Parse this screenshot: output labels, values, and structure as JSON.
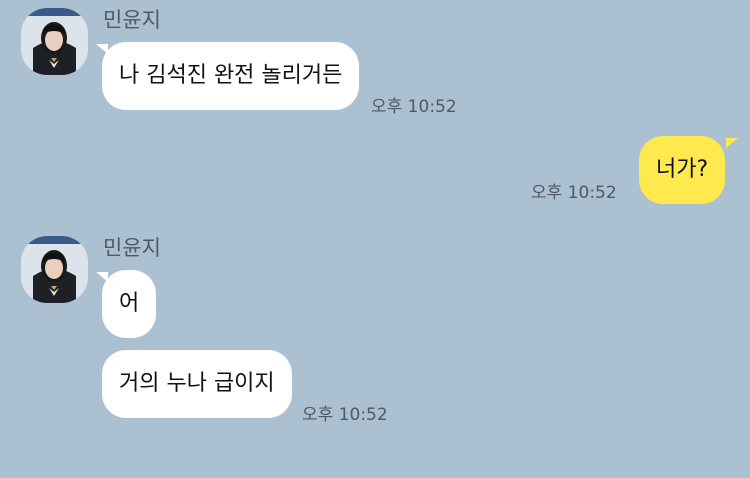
{
  "messages": [
    {
      "sender": "민윤지",
      "text": "나 김석진 완전 놀리거든",
      "time": "오후 10:52"
    },
    {
      "text": "너가?",
      "time": "오후 10:52"
    },
    {
      "sender": "민윤지",
      "texts": [
        "어",
        "거의 누나 급이지"
      ],
      "time": "오후 10:52"
    }
  ],
  "colors": {
    "background": "#abc1d1",
    "incoming_bubble": "#ffffff",
    "outgoing_bubble": "#fee94e"
  },
  "icons": {
    "profile": "avatar-photo"
  }
}
